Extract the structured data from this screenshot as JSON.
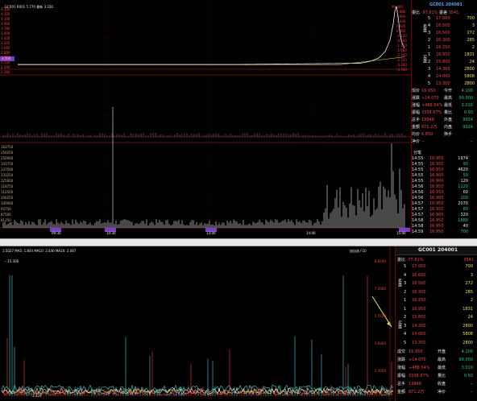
{
  "top": {
    "info_line": "GC001 R001 5.770 最新 3.320",
    "peak_label": "99.000",
    "title": "GC001 204001",
    "left_axis": [
      "4.500",
      "4.320",
      "4.140",
      "3.960",
      "3.780",
      "3.600",
      "3.420",
      "3.240",
      "3.060",
      "2.880",
      "2.700",
      "2.520",
      "2.340",
      "2.160"
    ],
    "right_axis": [
      "2.880",
      "1.960",
      "1.440",
      "0.920",
      "0.400",
      "-0.120",
      "-0.640",
      "-1.160",
      "-1.680",
      "-2.200",
      "-2.720",
      "-3.240",
      "-3.760"
    ],
    "volume_axis": [
      "162750",
      "156250",
      "150000",
      "143750",
      "137500",
      "131250",
      "125000",
      "118750",
      "112500",
      "106250",
      "100000",
      "93750",
      "87500",
      "81250"
    ],
    "time_labels": [
      "09:30",
      "10:30",
      "13:00",
      "14:00",
      "15:00"
    ],
    "current_box": "3.550",
    "order_book": {
      "header": [
        "委比",
        "-97.61%",
        "委差",
        "3541"
      ],
      "sell_side_label": "卖盘",
      "buy_side_label": "买盘",
      "rows": [
        {
          "lvl": "5",
          "price": "17.000",
          "vol": "700"
        },
        {
          "lvl": "4",
          "price": "16.500",
          "vol": "3"
        },
        {
          "lvl": "3",
          "price": "16.500",
          "vol": "272"
        },
        {
          "lvl": "2",
          "price": "16.300",
          "vol": "285"
        },
        {
          "lvl": "1",
          "price": "16.250",
          "vol": "2"
        },
        {
          "lvl": "1",
          "price": "16.950",
          "vol": "1831"
        },
        {
          "lvl": "2",
          "price": "15.800",
          "vol": "24"
        },
        {
          "lvl": "3",
          "price": "14.300",
          "vol": "2800"
        },
        {
          "lvl": "4",
          "price": "14.000",
          "vol": "5808"
        },
        {
          "lvl": "5",
          "price": "13.300",
          "vol": "2800"
        }
      ]
    },
    "stats": [
      [
        "现价",
        "16.950",
        "今开",
        "4.100"
      ],
      [
        "涨跌",
        "+14.070",
        "最高",
        "99.000"
      ],
      [
        "涨幅",
        "+488.54%",
        "最低",
        "3.010"
      ],
      [
        "振幅",
        "3338.67%",
        "量比",
        "0.93"
      ],
      [
        "总手",
        "19848",
        "外盘",
        "9924"
      ],
      [
        "金额",
        "871.2万",
        "内盘",
        "9924"
      ],
      [
        "均价",
        "6.850",
        "换手",
        ""
      ],
      [
        "净价",
        "--",
        "",
        "--"
      ]
    ],
    "ticks_header": "分笔",
    "ticks": [
      [
        "14:55",
        "16.950",
        "1974"
      ],
      [
        "14:55",
        "16.950",
        "90"
      ],
      [
        "14:55",
        "16.950",
        "4620"
      ],
      [
        "14:55",
        "16.900",
        "50"
      ],
      [
        "14:55",
        "16.900",
        "120"
      ],
      [
        "14:56",
        "16.950",
        "1120"
      ],
      [
        "14:56",
        "16.950",
        "60"
      ],
      [
        "14:56",
        "16.900",
        "200"
      ],
      [
        "14:57",
        "16.950",
        "2070"
      ],
      [
        "14:57",
        "16.950",
        "80"
      ],
      [
        "14:57",
        "16.900",
        "320"
      ],
      [
        "14:58",
        "16.950",
        "1880"
      ],
      [
        "14:58",
        "16.950",
        "40"
      ],
      [
        "14:59",
        "16.950",
        "700"
      ]
    ]
  },
  "toolbar": {
    "buttons": [
      "分时",
      "多日",
      "五日",
      "K线图",
      "分钟",
      "日线",
      "周线",
      "月线",
      "季线",
      "年线",
      "多周期",
      "指标",
      "财务",
      "资讯",
      "评论",
      "板块",
      "F10",
      "基本",
      "操作",
      "概览",
      "个股",
      "沪深",
      "盘口",
      "主力",
      "大单",
      "分析",
      "深度",
      "更多"
    ]
  },
  "bottom": {
    "legend": "1.5027  MA5: 1.844  MA10: 2.440  MA20: 2.087",
    "peak_label": "-- 15.300",
    "right_info": "加自选  F10",
    "title": "GC001 204001",
    "axis_values": [
      "8.8440",
      "7.2080",
      "5.5720",
      "3.9360",
      "2.3000"
    ],
    "bottom_label": "3.320",
    "order_book": {
      "header": [
        "委比",
        "-77.61%",
        "",
        "3541"
      ],
      "sell_side_label": "卖盘",
      "buy_side_label": "买盘",
      "rows": [
        {
          "lvl": "5",
          "price": "17.000",
          "vol": "700"
        },
        {
          "lvl": "4",
          "price": "16.600",
          "vol": "3"
        },
        {
          "lvl": "3",
          "price": "16.500",
          "vol": "272"
        },
        {
          "lvl": "2",
          "price": "16.300",
          "vol": "285"
        },
        {
          "lvl": "1",
          "price": "16.250",
          "vol": "2"
        },
        {
          "lvl": "1",
          "price": "16.950",
          "vol": "1831"
        },
        {
          "lvl": "2",
          "price": "15.800",
          "vol": "24"
        },
        {
          "lvl": "3",
          "price": "14.300",
          "vol": "2800"
        },
        {
          "lvl": "4",
          "price": "14.000",
          "vol": "5808"
        },
        {
          "lvl": "5",
          "price": "13.300",
          "vol": "2800"
        }
      ]
    },
    "stats": [
      [
        "成交",
        "16.950",
        "开盘",
        "4.100"
      ],
      [
        "涨跌",
        "+14.070",
        "最高",
        "99.000"
      ],
      [
        "涨幅",
        "+488.54%",
        "最低",
        "3.010"
      ],
      [
        "振幅",
        "3338.67%",
        "量比",
        "0.93"
      ],
      [
        "总手",
        "19848",
        "收盘",
        "--"
      ],
      [
        "金额",
        "871.2万",
        "净价",
        "--"
      ]
    ]
  },
  "colors": {
    "up": "#ff3d3d",
    "down": "#19d46b",
    "price_line": "#e9e9e9",
    "grid": "#5a0000",
    "volume_bar": "#d8d8d8",
    "accent_box": "#7b3bd0"
  }
}
